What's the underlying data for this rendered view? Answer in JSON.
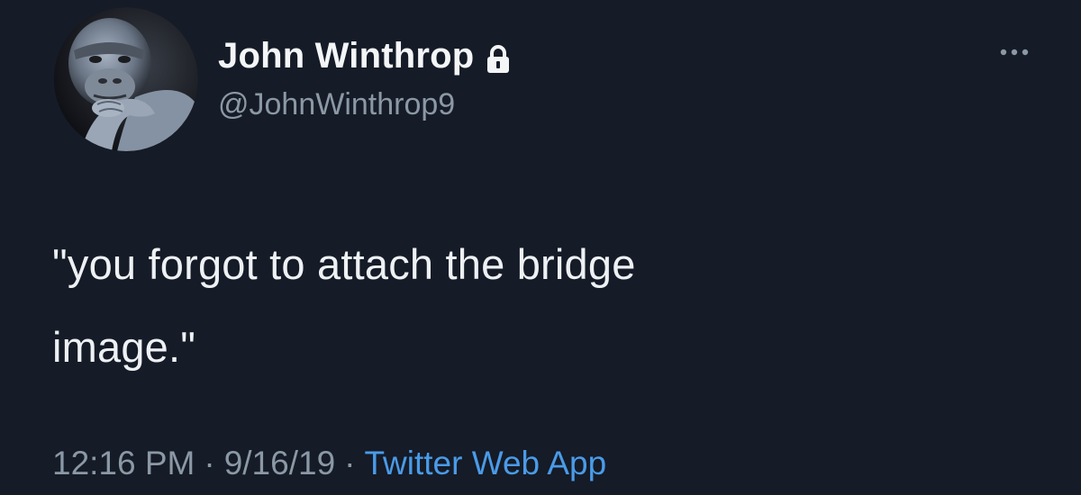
{
  "user": {
    "display_name": "John Winthrop",
    "handle": "@JohnWinthrop9",
    "avatar_icon": "gorilla-avatar",
    "protected_icon": "lock-icon"
  },
  "tweet": {
    "text_line_1": "\"you forgot to attach the bridge",
    "text_line_2": "image.\""
  },
  "meta": {
    "time": "12:16 PM",
    "separator": "·",
    "date": "9/16/19",
    "source": "Twitter Web App"
  },
  "actions": {
    "more_icon": "more-options-icon"
  },
  "colors": {
    "background": "#151b27",
    "text_primary": "#eef1f4",
    "text_secondary": "#8b98a5",
    "link": "#4a9be8"
  }
}
